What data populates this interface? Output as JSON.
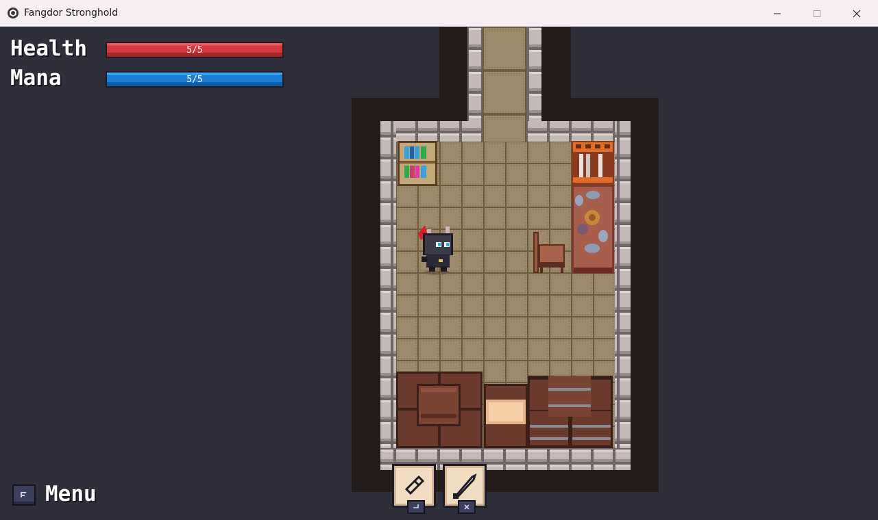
{
  "window": {
    "title": "Fangdor Stronghold"
  },
  "hud": {
    "health": {
      "label": "Health",
      "text": "5/5",
      "current": 5,
      "max": 5,
      "fraction": 1.0,
      "color": "#d4373d"
    },
    "mana": {
      "label": "Mana",
      "text": "5/5",
      "current": 5,
      "max": 5,
      "fraction": 1.0,
      "color": "#1b7fd6"
    }
  },
  "menu": {
    "label": "Menu",
    "key_icon": "escape-key-icon"
  },
  "action_slots": [
    {
      "icon": "interact-hand-icon",
      "key_icon": "enter-key-icon"
    },
    {
      "icon": "sword-icon",
      "key_icon": "x-key-icon"
    }
  ],
  "scene": {
    "room": "stone-walled storage room with wooden floor tiles",
    "objects": [
      "bookshelf-icon",
      "weapon-rack-icon",
      "table-icon",
      "chair-icon",
      "crate-icon",
      "bed-icon",
      "barrel-icon",
      "player-character-icon"
    ]
  }
}
